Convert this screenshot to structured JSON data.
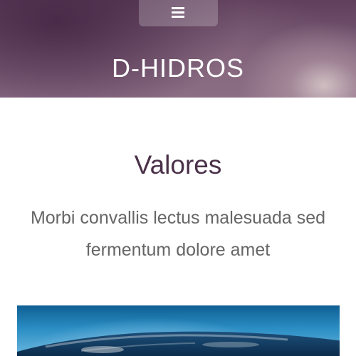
{
  "header": {
    "menu_icon": "hamburger-menu-icon",
    "site_title": "D-HIDROS"
  },
  "section": {
    "heading": "Valores",
    "text": "Morbi convallis lectus malesuada sed fermentum dolore amet"
  },
  "image": {
    "subject": "earth-horizon-image"
  },
  "colors": {
    "hero_base": "#6e4e69",
    "heading": "#4a3048",
    "body_text": "#666666",
    "background": "#ffffff"
  }
}
